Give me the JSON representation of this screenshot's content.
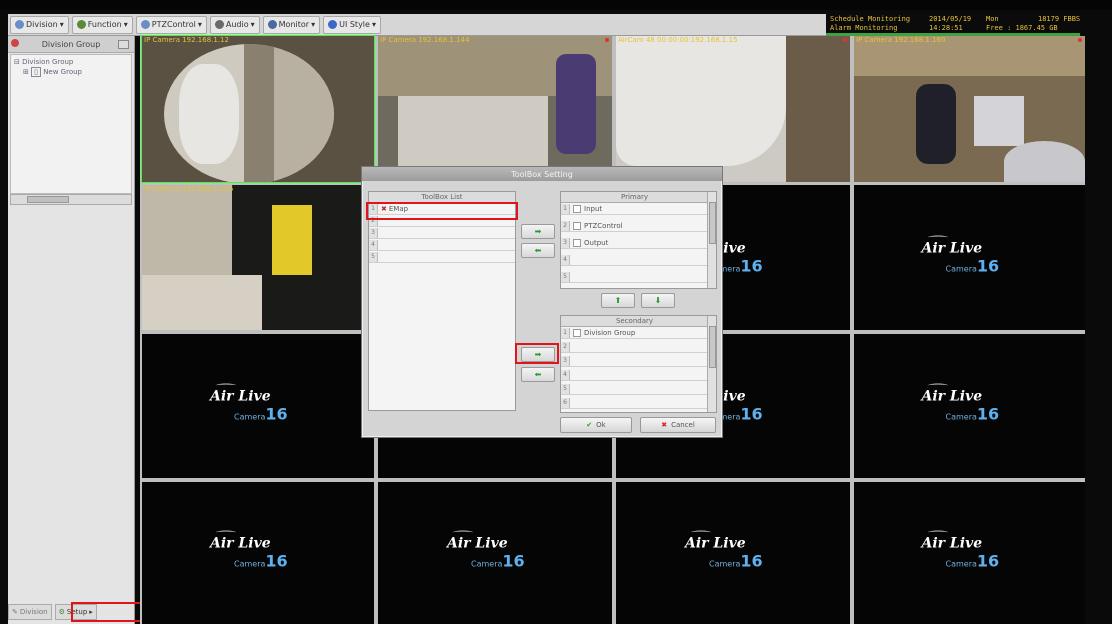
{
  "toolbar": {
    "items": [
      {
        "label": "Division",
        "icon": "division-icon",
        "color": "#6a8ec8"
      },
      {
        "label": "Function",
        "icon": "function-icon",
        "color": "#5a8a3a"
      },
      {
        "label": "PTZControl",
        "icon": "ptz-icon",
        "color": "#6a8ec8"
      },
      {
        "label": "Audio",
        "icon": "audio-icon",
        "color": "#6a6a6a"
      },
      {
        "label": "Monitor",
        "icon": "monitor-icon",
        "color": "#4a6aa0"
      },
      {
        "label": "UI Style",
        "icon": "ui-style-icon",
        "color": "#3a6ac8"
      }
    ]
  },
  "status": {
    "schedule": "Schedule Monitoring",
    "alarm": "Alarm Monitoring",
    "date": "2014/05/19",
    "time": "14:28:51",
    "day": "Mon",
    "free_label": "Free : 1867.45 GB",
    "fps": "18179 FBBS"
  },
  "left_panel": {
    "title": "Division Group",
    "tree": [
      {
        "label": "Division Group"
      },
      {
        "label": "New Group"
      }
    ]
  },
  "bottom_tabs": {
    "division": "Division",
    "setup": "Setup"
  },
  "cameras": [
    {
      "title": "IP Camera 192.168.1.12"
    },
    {
      "title": "IP Camera 192.168.1.144"
    },
    {
      "title": "AirCam 48 00:00:00:192.168.1.15"
    },
    {
      "title": "IP Camera 192.168.1.160"
    },
    {
      "title": "IP Camera 192.168.1.155"
    }
  ],
  "logo": {
    "brand": "Air Live",
    "sub": "Camera",
    "num": "16"
  },
  "dialog": {
    "title": "ToolBox Setting",
    "toolbox_list_header": "ToolBox List",
    "toolbox_items": [
      "EMap",
      "",
      "",
      "",
      ""
    ],
    "primary_header": "Primary",
    "primary_items": [
      "Input",
      "PTZControl",
      "Output",
      "",
      ""
    ],
    "secondary_header": "Secondary",
    "secondary_items": [
      "Division Group",
      "",
      "",
      "",
      "",
      ""
    ],
    "ok_label": "Ok",
    "cancel_label": "Cancel",
    "arrow_right": "➡",
    "arrow_left": "⬅",
    "arrow_up": "⬆",
    "arrow_down": "⬇"
  }
}
